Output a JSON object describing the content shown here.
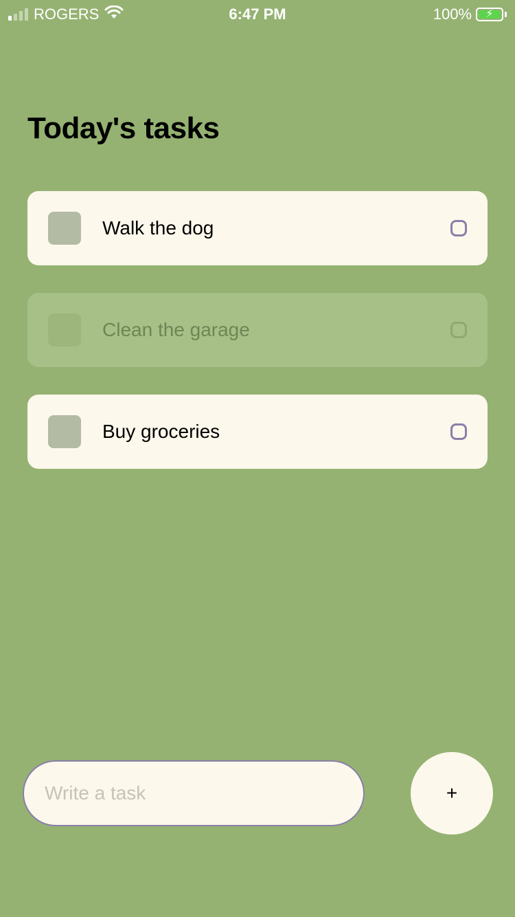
{
  "status_bar": {
    "carrier": "ROGERS",
    "time": "6:47 PM",
    "battery_percent": "100%",
    "signal_bars": 4,
    "signal_bars_active": 1,
    "icons": [
      "signal-icon",
      "wifi-icon",
      "battery-charging-icon"
    ]
  },
  "page": {
    "title": "Today's tasks"
  },
  "tasks": [
    {
      "label": "Walk the dog",
      "faded": false
    },
    {
      "label": "Clean the garage",
      "faded": true
    },
    {
      "label": "Buy groceries",
      "faded": false
    }
  ],
  "composer": {
    "placeholder": "Write a task",
    "value": "",
    "add_label": "+"
  },
  "colors": {
    "background": "#95b272",
    "card": "#fdf8ec",
    "accent": "#8a7fa9",
    "square": "#b3bba4",
    "battery_fill": "#5dd44e"
  }
}
